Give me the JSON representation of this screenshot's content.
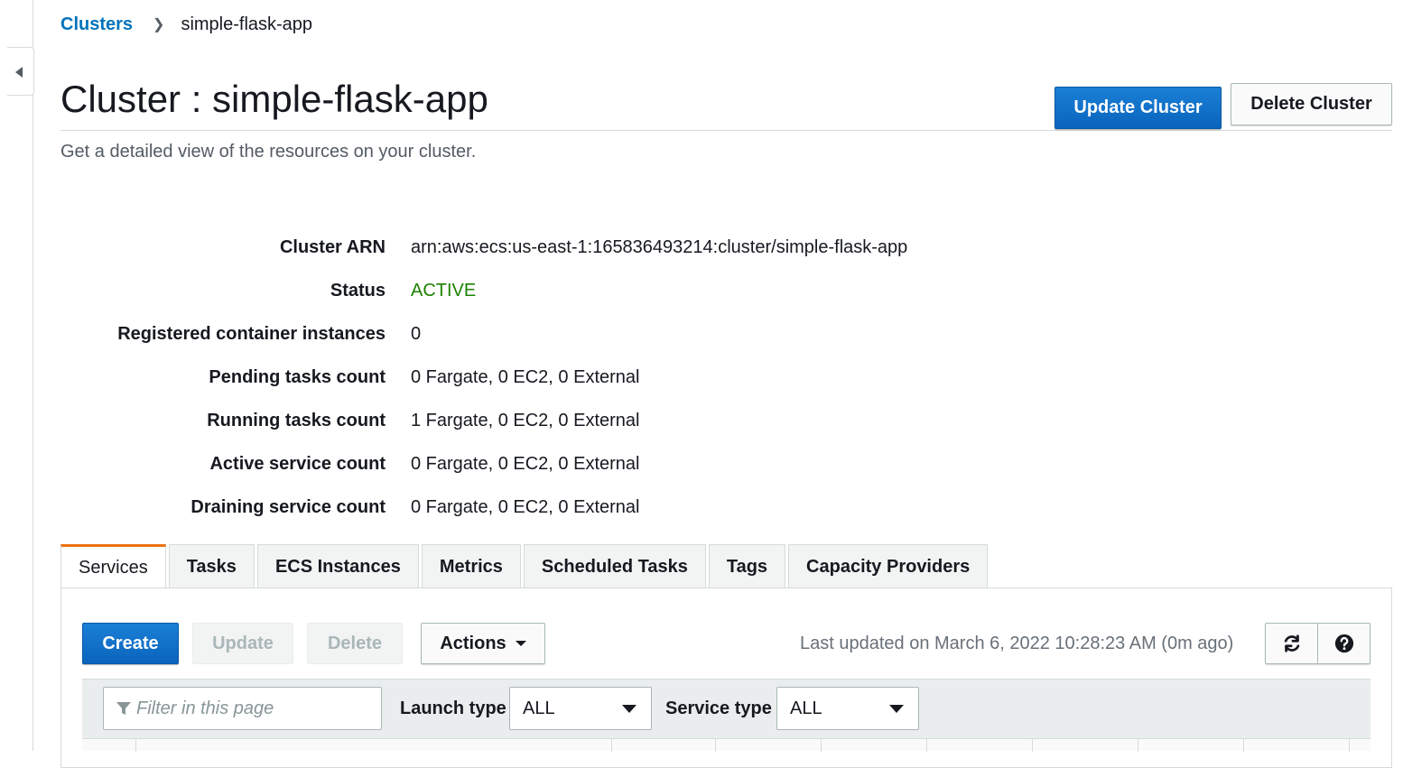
{
  "breadcrumb": {
    "root": "Clusters",
    "current": "simple-flask-app"
  },
  "header": {
    "title": "Cluster : simple-flask-app",
    "subtitle": "Get a detailed view of the resources on your cluster.",
    "update_label": "Update Cluster",
    "delete_label": "Delete Cluster"
  },
  "details": [
    {
      "label": "Cluster ARN",
      "value": "arn:aws:ecs:us-east-1:165836493214:cluster/simple-flask-app"
    },
    {
      "label": "Status",
      "value": "ACTIVE"
    },
    {
      "label": "Registered container instances",
      "value": "0"
    },
    {
      "label": "Pending tasks count",
      "value": "0 Fargate, 0 EC2, 0 External"
    },
    {
      "label": "Running tasks count",
      "value": "1 Fargate, 0 EC2, 0 External"
    },
    {
      "label": "Active service count",
      "value": "0 Fargate, 0 EC2, 0 External"
    },
    {
      "label": "Draining service count",
      "value": "0 Fargate, 0 EC2, 0 External"
    }
  ],
  "tabs": [
    "Services",
    "Tasks",
    "ECS Instances",
    "Metrics",
    "Scheduled Tasks",
    "Tags",
    "Capacity Providers"
  ],
  "toolbar": {
    "create": "Create",
    "update": "Update",
    "delete": "Delete",
    "actions": "Actions",
    "last_updated": "Last updated on March 6, 2022 10:28:23 AM (0m ago)"
  },
  "filters": {
    "search_placeholder": "Filter in this page",
    "launch_type_label": "Launch type",
    "launch_type_value": "ALL",
    "service_type_label": "Service type",
    "service_type_value": "ALL"
  },
  "colors": {
    "primary": "#0a64bd",
    "active": "#1d8102",
    "tab_accent": "#ec7211"
  },
  "icons": [
    "caret-left-icon",
    "chevron-right-icon",
    "caret-down-icon",
    "refresh-icon",
    "help-icon",
    "filter-icon"
  ]
}
